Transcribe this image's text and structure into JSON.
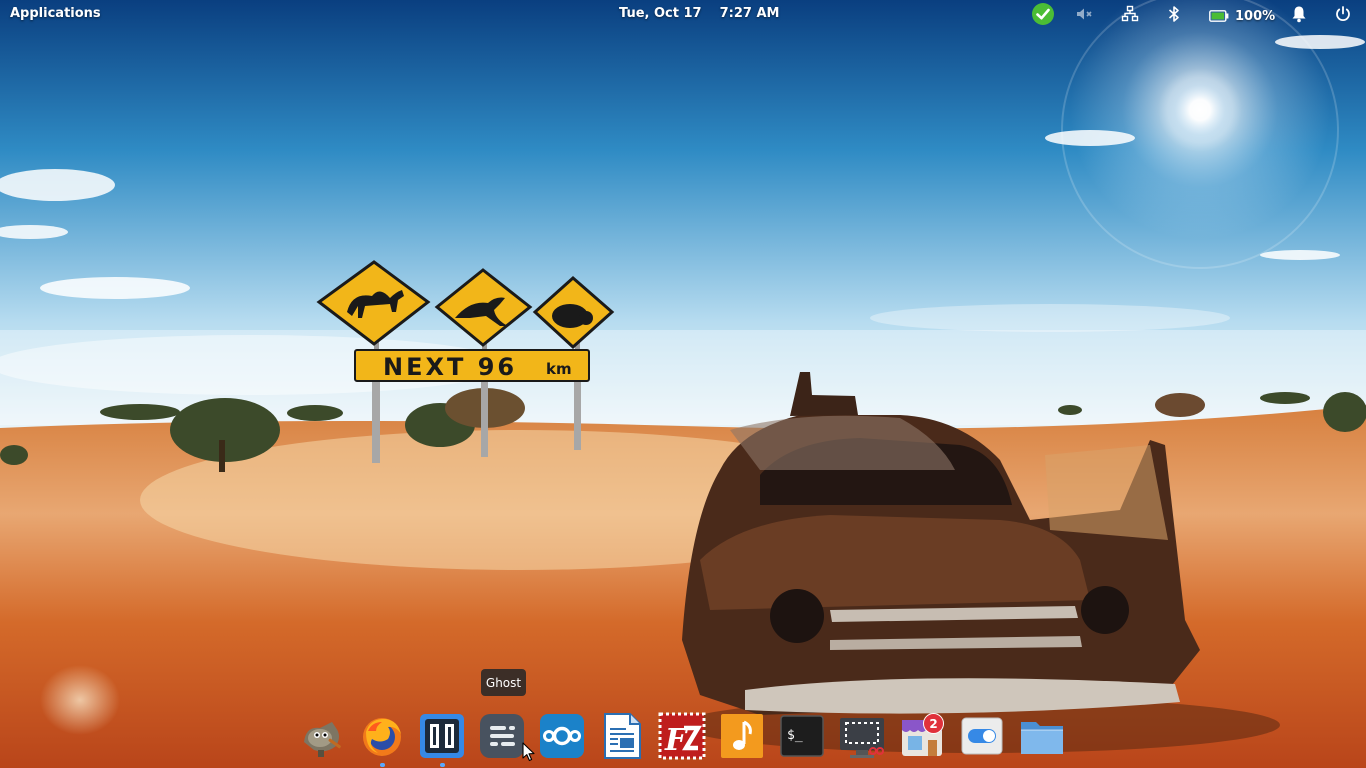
{
  "panel": {
    "applications_label": "Applications",
    "date": "Tue, Oct 17",
    "time": "7:27 AM",
    "battery_percent": "100%",
    "battery_level": 1.0
  },
  "wallpaper": {
    "sign_text": "NEXT 96",
    "sign_unit": "km"
  },
  "dock": {
    "tooltip": "Ghost",
    "badge_count": "2",
    "items": [
      {
        "name": "gimp"
      },
      {
        "name": "firefox"
      },
      {
        "name": "code-editor"
      },
      {
        "name": "ghost"
      },
      {
        "name": "nextcloud"
      },
      {
        "name": "libreoffice-writer"
      },
      {
        "name": "filezilla"
      },
      {
        "name": "music"
      },
      {
        "name": "terminal"
      },
      {
        "name": "screenshot"
      },
      {
        "name": "appcenter"
      },
      {
        "name": "system-settings"
      },
      {
        "name": "files"
      }
    ]
  },
  "colors": {
    "sky_top": "#0d4a8c",
    "sky_bottom": "#cfe6f4",
    "sand": "#d9732e",
    "sign_yellow": "#f2b619",
    "accent_blue": "#3689e6",
    "badge_red": "#e0313b",
    "indicator_green": "#4bbd35"
  }
}
